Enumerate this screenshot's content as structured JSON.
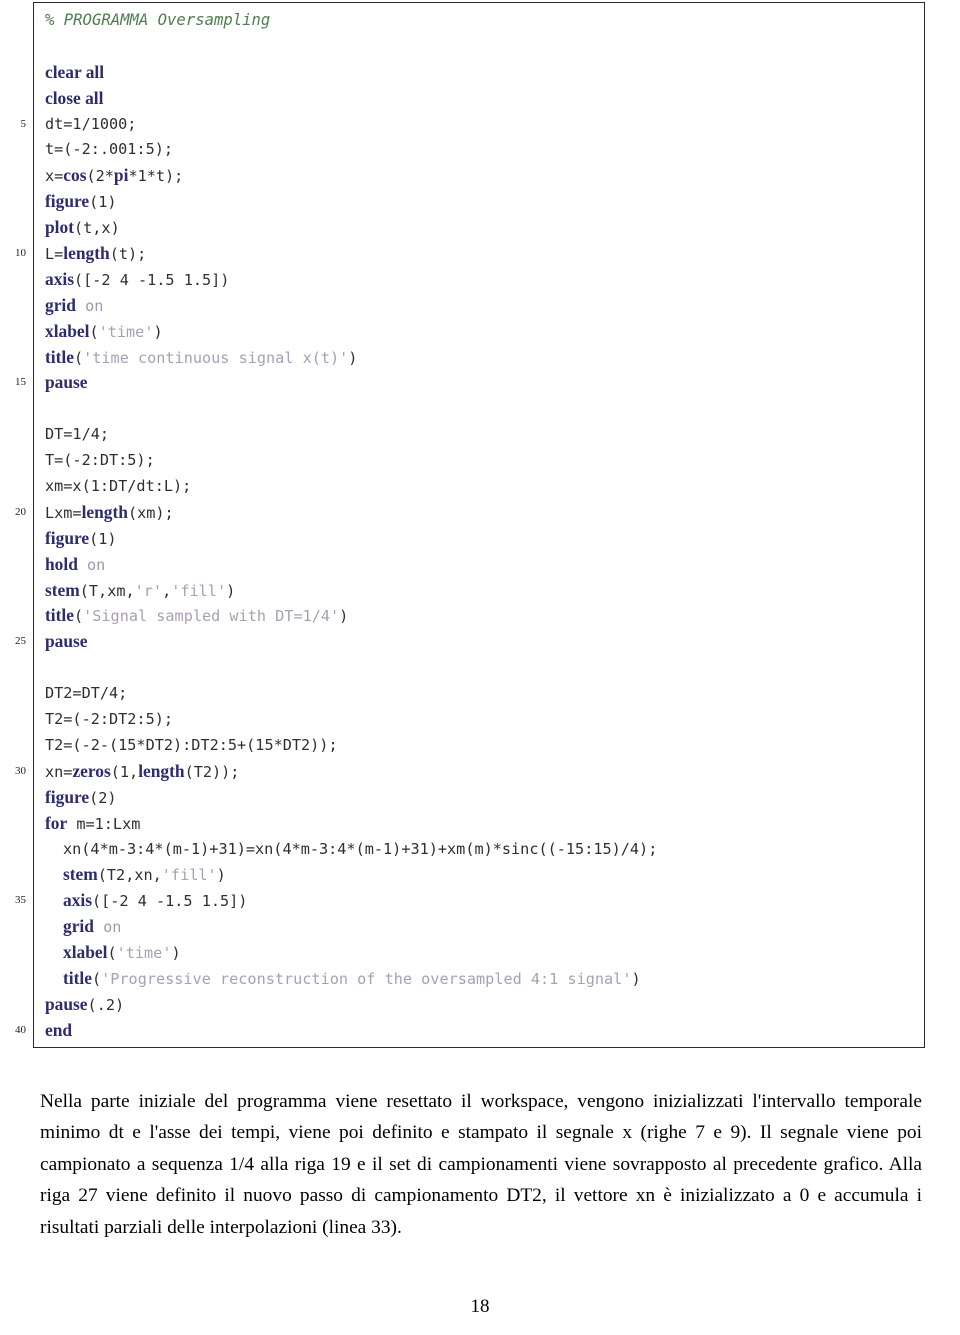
{
  "page": {
    "number": "18"
  },
  "listing": {
    "lines": [
      {
        "num": "",
        "indent": 0,
        "tokens": [
          {
            "t": "cmt",
            "v": "% PROGRAMMA Oversampling"
          }
        ]
      },
      {
        "num": "",
        "indent": 0,
        "tokens": []
      },
      {
        "num": "",
        "indent": 0,
        "tokens": [
          {
            "t": "kw",
            "v": "clear all"
          }
        ]
      },
      {
        "num": "",
        "indent": 0,
        "tokens": [
          {
            "t": "kw",
            "v": "close all"
          }
        ]
      },
      {
        "num": "5",
        "indent": 0,
        "tokens": [
          {
            "t": "pl",
            "v": "dt=1/1000;"
          }
        ]
      },
      {
        "num": "",
        "indent": 0,
        "tokens": [
          {
            "t": "pl",
            "v": "t=(-2:.001:5);"
          }
        ]
      },
      {
        "num": "",
        "indent": 0,
        "tokens": [
          {
            "t": "pl",
            "v": "x="
          },
          {
            "t": "kw",
            "v": "cos"
          },
          {
            "t": "pl",
            "v": "(2*"
          },
          {
            "t": "kw",
            "v": "pi"
          },
          {
            "t": "pl",
            "v": "*1*t);"
          }
        ]
      },
      {
        "num": "",
        "indent": 0,
        "tokens": [
          {
            "t": "kw",
            "v": "figure"
          },
          {
            "t": "pl",
            "v": "(1)"
          }
        ]
      },
      {
        "num": "",
        "indent": 0,
        "tokens": [
          {
            "t": "kw",
            "v": "plot"
          },
          {
            "t": "pl",
            "v": "(t,x)"
          }
        ]
      },
      {
        "num": "10",
        "indent": 0,
        "tokens": [
          {
            "t": "pl",
            "v": "L="
          },
          {
            "t": "kw",
            "v": "length"
          },
          {
            "t": "pl",
            "v": "(t);"
          }
        ]
      },
      {
        "num": "",
        "indent": 0,
        "tokens": [
          {
            "t": "kw",
            "v": "axis"
          },
          {
            "t": "pl",
            "v": "([-2 4 -1.5 1.5])"
          }
        ]
      },
      {
        "num": "",
        "indent": 0,
        "tokens": [
          {
            "t": "kw",
            "v": "grid"
          },
          {
            "t": "kw2",
            "v": " on"
          }
        ]
      },
      {
        "num": "",
        "indent": 0,
        "tokens": [
          {
            "t": "kw",
            "v": "xlabel"
          },
          {
            "t": "pl",
            "v": "("
          },
          {
            "t": "str",
            "v": "'time'"
          },
          {
            "t": "pl",
            "v": ")"
          }
        ]
      },
      {
        "num": "",
        "indent": 0,
        "tokens": [
          {
            "t": "kw",
            "v": "title"
          },
          {
            "t": "pl",
            "v": "("
          },
          {
            "t": "str",
            "v": "'time continuous signal x(t)'"
          },
          {
            "t": "pl",
            "v": ")"
          }
        ]
      },
      {
        "num": "15",
        "indent": 0,
        "tokens": [
          {
            "t": "kw",
            "v": "pause"
          }
        ]
      },
      {
        "num": "",
        "indent": 0,
        "tokens": []
      },
      {
        "num": "",
        "indent": 0,
        "tokens": [
          {
            "t": "pl",
            "v": "DT=1/4;"
          }
        ]
      },
      {
        "num": "",
        "indent": 0,
        "tokens": [
          {
            "t": "pl",
            "v": "T=(-2:DT:5);"
          }
        ]
      },
      {
        "num": "",
        "indent": 0,
        "tokens": [
          {
            "t": "pl",
            "v": "xm=x(1:DT/dt:L);"
          }
        ]
      },
      {
        "num": "20",
        "indent": 0,
        "tokens": [
          {
            "t": "pl",
            "v": "Lxm="
          },
          {
            "t": "kw",
            "v": "length"
          },
          {
            "t": "pl",
            "v": "(xm);"
          }
        ]
      },
      {
        "num": "",
        "indent": 0,
        "tokens": [
          {
            "t": "kw",
            "v": "figure"
          },
          {
            "t": "pl",
            "v": "(1)"
          }
        ]
      },
      {
        "num": "",
        "indent": 0,
        "tokens": [
          {
            "t": "kw",
            "v": "hold"
          },
          {
            "t": "kw2",
            "v": " on"
          }
        ]
      },
      {
        "num": "",
        "indent": 0,
        "tokens": [
          {
            "t": "kw",
            "v": "stem"
          },
          {
            "t": "pl",
            "v": "(T,xm,"
          },
          {
            "t": "str",
            "v": "'r'"
          },
          {
            "t": "pl",
            "v": ","
          },
          {
            "t": "str",
            "v": "'fill'"
          },
          {
            "t": "pl",
            "v": ")"
          }
        ]
      },
      {
        "num": "",
        "indent": 0,
        "tokens": [
          {
            "t": "kw",
            "v": "title"
          },
          {
            "t": "pl",
            "v": "("
          },
          {
            "t": "str",
            "v": "'Signal sampled with DT=1/4'"
          },
          {
            "t": "pl",
            "v": ")"
          }
        ]
      },
      {
        "num": "25",
        "indent": 0,
        "tokens": [
          {
            "t": "kw",
            "v": "pause"
          }
        ]
      },
      {
        "num": "",
        "indent": 0,
        "tokens": []
      },
      {
        "num": "",
        "indent": 0,
        "tokens": [
          {
            "t": "pl",
            "v": "DT2=DT/4;"
          }
        ]
      },
      {
        "num": "",
        "indent": 0,
        "tokens": [
          {
            "t": "pl",
            "v": "T2=(-2:DT2:5);"
          }
        ]
      },
      {
        "num": "",
        "indent": 0,
        "tokens": [
          {
            "t": "pl",
            "v": "T2=(-2-(15*DT2):DT2:5+(15*DT2));"
          }
        ]
      },
      {
        "num": "30",
        "indent": 0,
        "tokens": [
          {
            "t": "pl",
            "v": "xn="
          },
          {
            "t": "kw",
            "v": "zeros"
          },
          {
            "t": "pl",
            "v": "(1,"
          },
          {
            "t": "kw",
            "v": "length"
          },
          {
            "t": "pl",
            "v": "(T2));"
          }
        ]
      },
      {
        "num": "",
        "indent": 0,
        "tokens": [
          {
            "t": "kw",
            "v": "figure"
          },
          {
            "t": "pl",
            "v": "(2)"
          }
        ]
      },
      {
        "num": "",
        "indent": 0,
        "tokens": [
          {
            "t": "kw",
            "v": "for"
          },
          {
            "t": "pl",
            "v": " m=1:Lxm"
          }
        ]
      },
      {
        "num": "",
        "indent": 1,
        "tokens": [
          {
            "t": "pl",
            "v": "xn(4*m-3:4*(m-1)+31)=xn(4*m-3:4*(m-1)+31)+xm(m)*sinc((-15:15)/4);"
          }
        ]
      },
      {
        "num": "",
        "indent": 1,
        "tokens": [
          {
            "t": "kw",
            "v": "stem"
          },
          {
            "t": "pl",
            "v": "(T2,xn,"
          },
          {
            "t": "str",
            "v": "'fill'"
          },
          {
            "t": "pl",
            "v": ")"
          }
        ]
      },
      {
        "num": "35",
        "indent": 1,
        "tokens": [
          {
            "t": "kw",
            "v": "axis"
          },
          {
            "t": "pl",
            "v": "([-2 4 -1.5 1.5])"
          }
        ]
      },
      {
        "num": "",
        "indent": 1,
        "tokens": [
          {
            "t": "kw",
            "v": "grid"
          },
          {
            "t": "kw2",
            "v": " on"
          }
        ]
      },
      {
        "num": "",
        "indent": 1,
        "tokens": [
          {
            "t": "kw",
            "v": "xlabel"
          },
          {
            "t": "pl",
            "v": "("
          },
          {
            "t": "str",
            "v": "'time'"
          },
          {
            "t": "pl",
            "v": ")"
          }
        ]
      },
      {
        "num": "",
        "indent": 1,
        "tokens": [
          {
            "t": "kw",
            "v": "title"
          },
          {
            "t": "pl",
            "v": "("
          },
          {
            "t": "str",
            "v": "'Progressive reconstruction of the oversampled 4:1 signal'"
          },
          {
            "t": "pl",
            "v": ")"
          }
        ]
      },
      {
        "num": "",
        "indent": 0,
        "tokens": [
          {
            "t": "kw",
            "v": "pause"
          },
          {
            "t": "pl",
            "v": "(.2)"
          }
        ]
      },
      {
        "num": "40",
        "indent": 0,
        "tokens": [
          {
            "t": "kw",
            "v": "end"
          }
        ]
      }
    ]
  },
  "prose": {
    "paragraph": "Nella parte iniziale del programma viene resettato il workspace, vengono inizializzati l'intervallo temporale minimo dt e l'asse dei tempi, viene poi definito e stampato il segnale x (righe 7 e 9). Il segnale viene poi campionato a sequenza 1/4 alla riga 19 e il set di campionamenti viene sovrapposto al precedente grafico. Alla riga 27 viene definito il nuovo passo di campionamento DT2, il vettore xn è inizializzato a 0 e accumula i risultati parziali delle interpolazioni (linea 33)."
  },
  "colors": {
    "keyword": "#2c2c6e",
    "keyword_secondary": "#9a9ab0",
    "string": "#a99fb5",
    "comment": "#4f7d4f",
    "plain": "#2f2f2f",
    "frame": "#2b2b2b"
  }
}
